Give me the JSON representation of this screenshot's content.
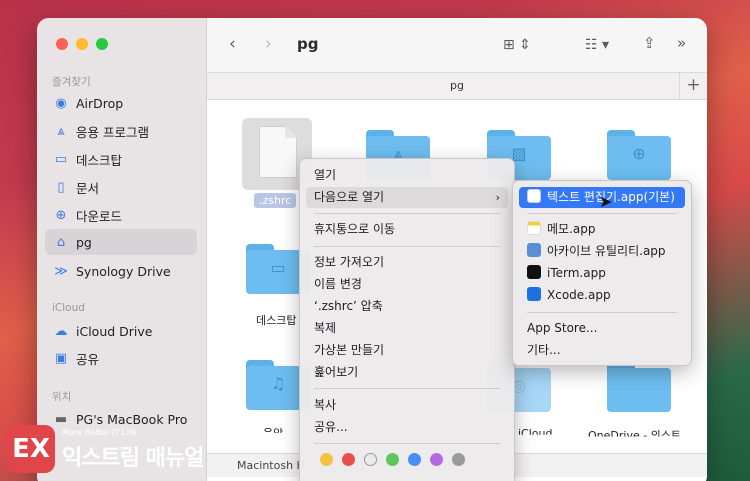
{
  "window": {
    "title": "pg",
    "path_title": "pg"
  },
  "sidebar": {
    "sections": [
      {
        "label": "즐겨찾기"
      },
      {
        "label": "iCloud"
      },
      {
        "label": "위치"
      }
    ],
    "favorites": [
      {
        "label": "AirDrop",
        "icon": "airdrop-icon"
      },
      {
        "label": "응용 프로그램",
        "icon": "applications-icon"
      },
      {
        "label": "데스크탑",
        "icon": "desktop-icon"
      },
      {
        "label": "문서",
        "icon": "document-icon"
      },
      {
        "label": "다운로드",
        "icon": "download-icon"
      },
      {
        "label": "pg",
        "icon": "home-icon"
      },
      {
        "label": "Synology Drive",
        "icon": "synology-icon"
      }
    ],
    "icloud": [
      {
        "label": "iCloud Drive",
        "icon": "cloud-icon"
      },
      {
        "label": "공유",
        "icon": "shared-folder-icon"
      }
    ],
    "locations": [
      {
        "label": "PG's MacBook Pro",
        "icon": "laptop-icon"
      }
    ]
  },
  "files": {
    "selected": ".zshrc",
    "folder_labels": [
      "데스크탑",
      "음악",
      "iCloud",
      "OneDrive - 의스트"
    ]
  },
  "context_menu": {
    "items": [
      "열기",
      "다음으로 열기",
      "휴지통으로 이동",
      "정보 가져오기",
      "이름 변경",
      "‘.zshrc’ 압축",
      "복제",
      "가상본 만들기",
      "훑어보기",
      "복사",
      "공유..."
    ]
  },
  "open_with_menu": {
    "default": "텍스트 편집기.app(기본)",
    "apps": [
      "메모.app",
      "아카이브 유틸리티.app",
      "iTerm.app",
      "Xcode.app"
    ],
    "app_store": "App Store...",
    "other": "기타..."
  },
  "statusbar": {
    "disk": "Macintosh H"
  },
  "tag_colors": [
    "#f5c342",
    "#e8504c",
    "#d8d6d6",
    "#5cc85c",
    "#4a8ef5",
    "#b36ce0",
    "#9a9a9a"
  ],
  "logo": {
    "tagline": "More Better IT Life",
    "name": "익스트림 매뉴얼",
    "mark": "EX"
  }
}
